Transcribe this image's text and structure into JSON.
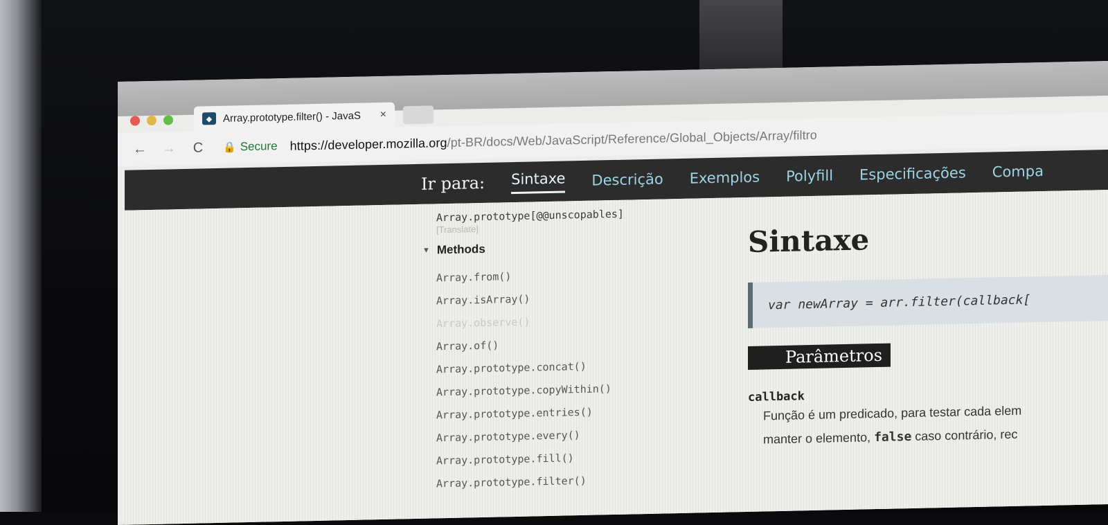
{
  "browser": {
    "tab_title": "Array.prototype.filter() - JavaS",
    "tab_close": "×",
    "url_scheme_host": "https://developer.mozilla.org",
    "url_path": "/pt-BR/docs/Web/JavaScript/Reference/Global_Objects/Array/filtro",
    "secure_label": "Secure",
    "icons": {
      "back": "←",
      "forward": "→",
      "reload": "C",
      "lock": "🔒"
    }
  },
  "jumpbar": {
    "label": "Ir para:",
    "links": [
      "Sintaxe",
      "Descrição",
      "Exemplos",
      "Polyfill",
      "Especificações",
      "Compa"
    ],
    "active_index": 0
  },
  "sidebar": {
    "top_item": "Array.prototype[@@unscopables]",
    "translate": "[Translate]",
    "section": "Methods",
    "items": [
      "Array.from()",
      "Array.isArray()",
      "Array.observe()",
      "Array.of()",
      "Array.prototype.concat()",
      "Array.prototype.copyWithin()",
      "Array.prototype.entries()",
      "Array.prototype.every()",
      "Array.prototype.fill()",
      "Array.prototype.filter()"
    ]
  },
  "main": {
    "heading": "Sintaxe",
    "code": "var newArray = arr.filter(callback[",
    "params_heading": "Parâmetros",
    "param_name": "callback",
    "param_desc_1": "Função é um predicado, para testar cada elem",
    "param_desc_2_pre": "manter o elemento, ",
    "param_desc_2_code": "false",
    "param_desc_2_post": " caso contrário, rec"
  },
  "colors": {
    "jumpbar_bg": "#2c2c2c",
    "jump_link": "#9ed3e6",
    "secure_green": "#1e7b34",
    "code_border": "#5a6a70"
  }
}
